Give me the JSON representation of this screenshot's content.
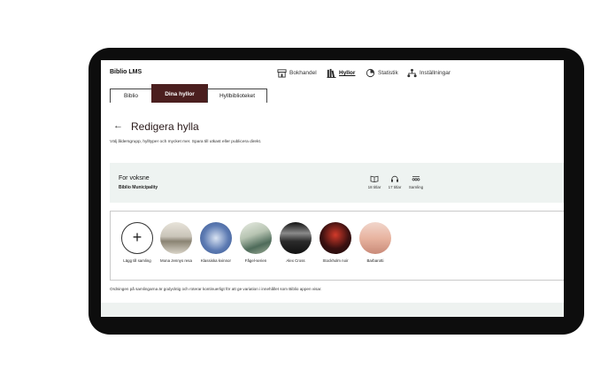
{
  "app": {
    "brand": "Biblio LMS"
  },
  "nav": [
    {
      "label": "Bokhandel",
      "icon": "store-icon",
      "active": false
    },
    {
      "label": "Hyllor",
      "icon": "books-icon",
      "active": true
    },
    {
      "label": "Statistik",
      "icon": "pie-chart-icon",
      "active": false
    },
    {
      "label": "Inställningar",
      "icon": "hierarchy-icon",
      "active": false
    }
  ],
  "tabs": [
    {
      "label": "Biblio",
      "active": false
    },
    {
      "label": "Dina hyllor",
      "active": true
    },
    {
      "label": "Hyllbiblioteket",
      "active": false
    }
  ],
  "page": {
    "back_icon": "arrow-left-icon",
    "title": "Redigera hylla",
    "subtitle": "Välj åldersgrupp, hylltyper och mycket mer. Spara till utkast eller publicera direkt."
  },
  "shelf": {
    "name": "For voksne",
    "owner": "Biblio Municipality",
    "stats": [
      {
        "icon": "book-open-icon",
        "label": "18 titlar"
      },
      {
        "icon": "headphones-icon",
        "label": "17 titlar"
      },
      {
        "icon": "collection-icon",
        "label": "Samling"
      }
    ]
  },
  "collections": [
    {
      "label": "Lägg till samling",
      "type": "add"
    },
    {
      "label": "Mona Jennys resa",
      "colors": [
        "#c9c4b9",
        "#8a8373",
        "#e8e4da"
      ]
    },
    {
      "label": "Klassiska kvinnor",
      "colors": [
        "#5d7bb3",
        "#d9e3f2",
        "#3a5890"
      ]
    },
    {
      "label": "Fågel-serien",
      "colors": [
        "#b7c4b2",
        "#4e6b5a",
        "#e9ede4"
      ]
    },
    {
      "label": "Alex Cross",
      "colors": [
        "#2b2b2b",
        "#8a8a8a",
        "#111111"
      ]
    },
    {
      "label": "Stockholm noir",
      "colors": [
        "#3a1010",
        "#d23a2a",
        "#1a0a0a"
      ]
    },
    {
      "label": "Barbarotti",
      "colors": [
        "#f1d6cc",
        "#e8b4a0",
        "#c98a78"
      ]
    }
  ],
  "footnote": "Ordningen på samlingarna är godycktig och roterar kontinuerligt för att ge variation i innehållet som Biblio appen visar.",
  "colors": {
    "accent": "#4b1f1f",
    "card_bg": "#eef3f1",
    "device": "#0d0d0d"
  }
}
